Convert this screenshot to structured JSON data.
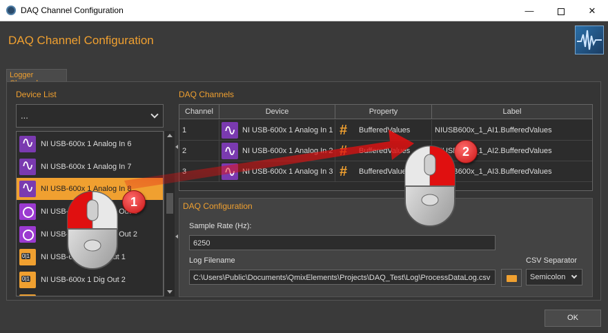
{
  "window": {
    "title": "DAQ Channel Configuration",
    "min": "—",
    "max": "",
    "close": "✕"
  },
  "header": {
    "title": "DAQ Channel Configuration",
    "logo_icon": "waveform-logo-icon"
  },
  "tabs": [
    {
      "label": "Logger Channels"
    }
  ],
  "device_list": {
    "label": "Device List",
    "dropdown_value": "...",
    "items": [
      {
        "label": "NI USB-600x 1 Analog In 6",
        "icon": "sine-wave-icon"
      },
      {
        "label": "NI USB-600x 1 Analog In 7",
        "icon": "sine-wave-icon"
      },
      {
        "label": "NI USB-600x 1 Analog In 8",
        "icon": "sine-wave-icon",
        "selected": true
      },
      {
        "label": "NI USB-600x 1 Analog Out 1",
        "icon": "gauge-icon"
      },
      {
        "label": "NI USB-600x 1 Analog Out 2",
        "icon": "gauge-icon"
      },
      {
        "label": "NI USB-600x 1 Dig Out 1",
        "icon": "digital-out-icon"
      },
      {
        "label": "NI USB-600x 1 Dig Out 2",
        "icon": "digital-out-icon"
      },
      {
        "label": "",
        "icon": "digital-out-icon"
      }
    ]
  },
  "daq_channels": {
    "label": "DAQ Channels",
    "columns": [
      "Channel",
      "Device",
      "Property",
      "Label"
    ],
    "rows": [
      {
        "channel": "1",
        "device": "NI USB-600x 1 Analog In 1",
        "property": "BufferedValues",
        "label": "NIUSB600x_1_AI1.BufferedValues"
      },
      {
        "channel": "2",
        "device": "NI USB-600x 1 Analog In 2",
        "property": "BufferedValues",
        "label": "NIUSB600x_1_AI2.BufferedValues"
      },
      {
        "channel": "3",
        "device": "NI USB-600x 1 Analog In 3",
        "property": "BufferedValues",
        "label": "NIUSB600x_1_AI3.BufferedValues"
      }
    ]
  },
  "daq_configuration": {
    "label": "DAQ Configuration",
    "sample_rate_label": "Sample Rate (Hz):",
    "sample_rate_value": "6250",
    "log_filename_label": "Log Filename",
    "log_filename_value": "C:\\Users\\Public\\Documents\\QmixElements\\Projects\\DAQ_Test\\Log\\ProcessDataLog.csv",
    "csv_separator_label": "CSV Separator",
    "csv_separator_value": "Semicolon"
  },
  "ok_button": "OK",
  "annotations": {
    "step1": "1",
    "step2": "2"
  },
  "colors": {
    "accent": "#f0a030",
    "background": "#3a3a3a",
    "arrow": "#e01010"
  }
}
